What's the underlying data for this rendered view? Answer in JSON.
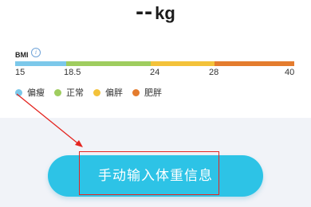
{
  "weight": {
    "value": "--",
    "unit": "kg"
  },
  "bmi": {
    "label": "BMI",
    "info_icon": "info-icon",
    "ticks": [
      "15",
      "18.5",
      "24",
      "28",
      "40"
    ],
    "segments": [
      {
        "name": "偏瘦",
        "color": "#7cc8ea"
      },
      {
        "name": "正常",
        "color": "#9fcd5f"
      },
      {
        "name": "偏胖",
        "color": "#f3c23a"
      },
      {
        "name": "肥胖",
        "color": "#e47c2e"
      }
    ]
  },
  "action": {
    "manual_input_label": "手动输入体重信息",
    "button_color": "#2dc3e6"
  },
  "annotation": {
    "color": "#e42520"
  }
}
